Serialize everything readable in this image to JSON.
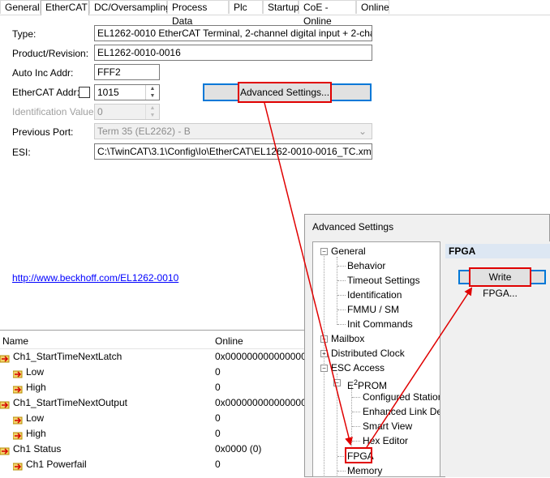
{
  "tabs": [
    "General",
    "EtherCAT",
    "DC/Oversampling",
    "Process Data",
    "Plc",
    "Startup",
    "CoE - Online",
    "Online"
  ],
  "active_tab": "EtherCAT",
  "form": {
    "type_label": "Type:",
    "type_value": "EL1262-0010 EtherCAT Terminal, 2-channel digital input + 2-channel di",
    "product_label": "Product/Revision:",
    "product_value": "EL1262-0010-0016",
    "auto_inc_label": "Auto Inc Addr:",
    "auto_inc_value": "FFF2",
    "ethercat_addr_label": "EtherCAT Addr:",
    "ethercat_addr_value": "1015",
    "ident_label": "Identification Value:",
    "ident_value": "0",
    "prev_port_label": "Previous Port:",
    "prev_port_value": "Term 35 (EL2262) - B",
    "esi_label": "ESI:",
    "esi_value": "C:\\TwinCAT\\3.1\\Config\\Io\\EtherCAT\\EL1262-0010-0016_TC.xml",
    "advanced_button": "Advanced Settings...",
    "link": "http://www.beckhoff.com/EL1262-0010"
  },
  "list": {
    "headers": [
      "Name",
      "Online"
    ],
    "rows": [
      {
        "name": "Ch1_StartTimeNextLatch",
        "online": "0x0000000000000000",
        "level": 0
      },
      {
        "name": "Low",
        "online": "0",
        "level": 1
      },
      {
        "name": "High",
        "online": "0",
        "level": 1
      },
      {
        "name": "Ch1_StartTimeNextOutput",
        "online": "0x0000000000000000",
        "level": 0
      },
      {
        "name": "Low",
        "online": "0",
        "level": 1
      },
      {
        "name": "High",
        "online": "0",
        "level": 1
      },
      {
        "name": "Ch1 Status",
        "online": "0x0000 (0)",
        "level": 0
      },
      {
        "name": "Ch1 Powerfail",
        "online": "0",
        "level": 1
      }
    ]
  },
  "dialog": {
    "title": "Advanced Settings",
    "tree": {
      "general": "General",
      "behavior": "Behavior",
      "timeout": "Timeout Settings",
      "identification": "Identification",
      "fmmu": "FMMU / SM",
      "init": "Init Commands",
      "mailbox": "Mailbox",
      "dc": "Distributed Clock",
      "esc": "ESC Access",
      "eprom_pre": "E",
      "eprom_sup": "2",
      "eprom_post": "PROM",
      "configured": "Configured Station",
      "enhanced": "Enhanced Link De",
      "smart": "Smart View",
      "hex": "Hex Editor",
      "fpga": "FPGA",
      "memory": "Memory"
    },
    "panel_title": "FPGA",
    "write_button": "Write FPGA..."
  },
  "colors": {
    "highlight": "#e00000",
    "focus": "#0078d7",
    "panel_header": "#dde7f3"
  }
}
